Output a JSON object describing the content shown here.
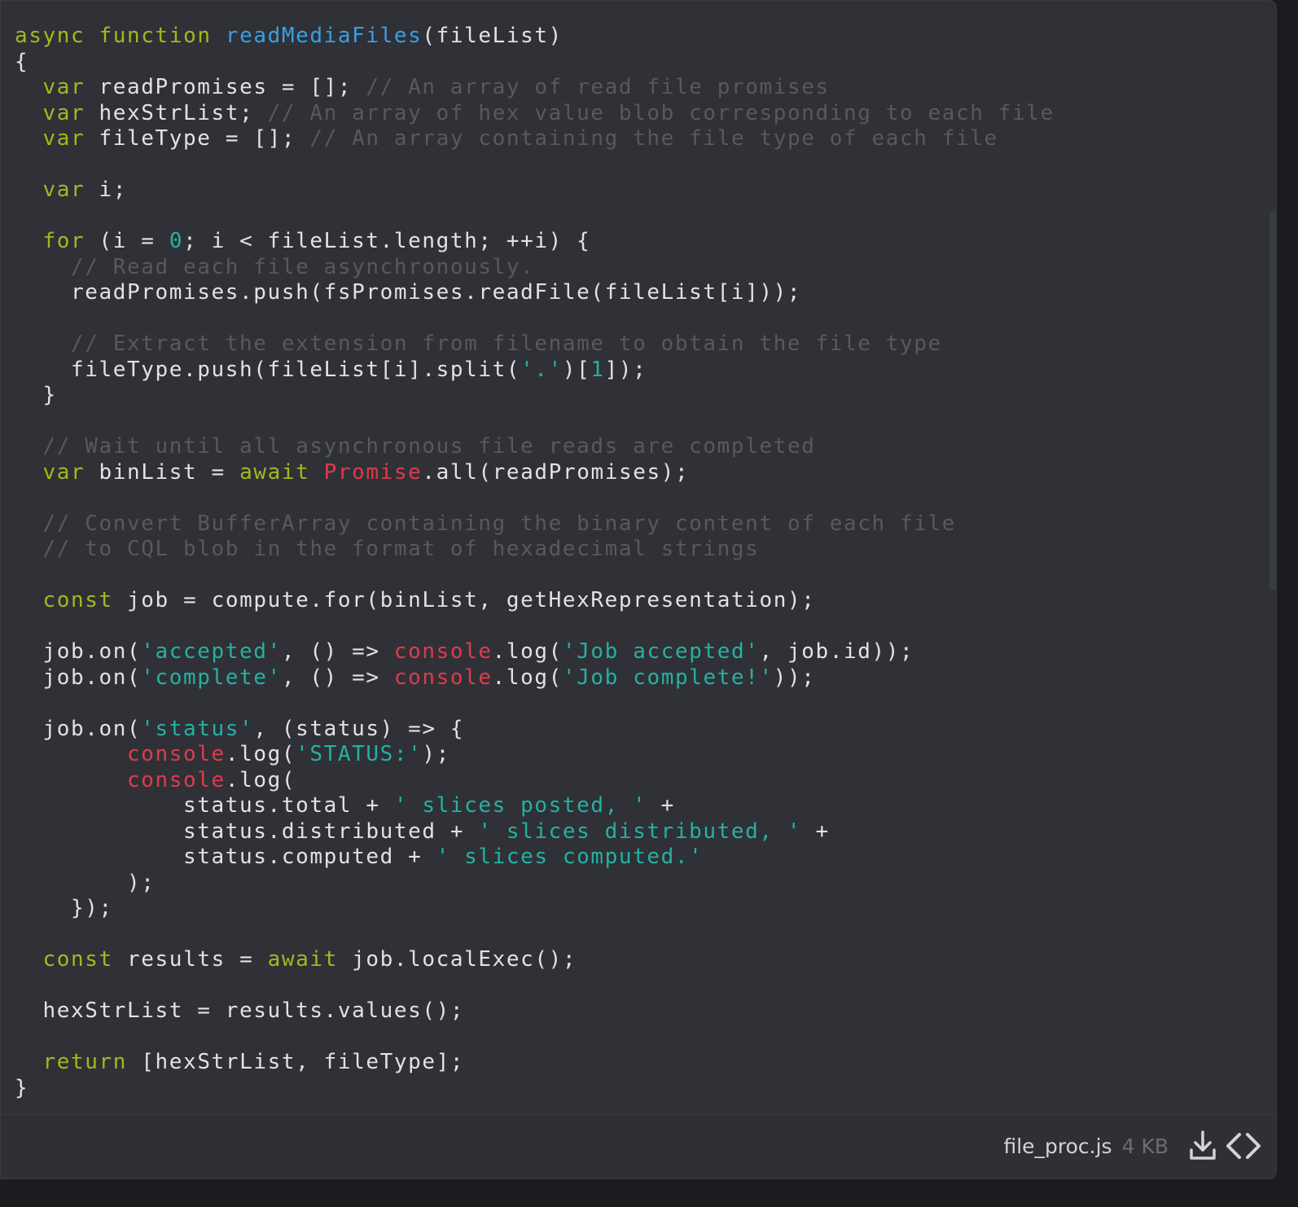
{
  "code_lines": [
    [
      {
        "t": "kw",
        "v": "async"
      },
      {
        "t": "pl",
        "v": " "
      },
      {
        "t": "kw",
        "v": "function"
      },
      {
        "t": "pl",
        "v": " "
      },
      {
        "t": "fn",
        "v": "readMediaFiles"
      },
      {
        "t": "pl",
        "v": "(fileList)"
      }
    ],
    [
      {
        "t": "pl",
        "v": "{"
      }
    ],
    [
      {
        "t": "pl",
        "v": "  "
      },
      {
        "t": "kw",
        "v": "var"
      },
      {
        "t": "pl",
        "v": " readPromises = []; "
      },
      {
        "t": "cm",
        "v": "// An array of read file promises"
      }
    ],
    [
      {
        "t": "pl",
        "v": "  "
      },
      {
        "t": "kw",
        "v": "var"
      },
      {
        "t": "pl",
        "v": " hexStrList; "
      },
      {
        "t": "cm",
        "v": "// An array of hex value blob corresponding to each file"
      }
    ],
    [
      {
        "t": "pl",
        "v": "  "
      },
      {
        "t": "kw",
        "v": "var"
      },
      {
        "t": "pl",
        "v": " fileType = []; "
      },
      {
        "t": "cm",
        "v": "// An array containing the file type of each file"
      }
    ],
    [],
    [
      {
        "t": "pl",
        "v": "  "
      },
      {
        "t": "kw",
        "v": "var"
      },
      {
        "t": "pl",
        "v": " i;"
      }
    ],
    [],
    [
      {
        "t": "pl",
        "v": "  "
      },
      {
        "t": "kw",
        "v": "for"
      },
      {
        "t": "pl",
        "v": " (i = "
      },
      {
        "t": "num",
        "v": "0"
      },
      {
        "t": "pl",
        "v": "; i < fileList.length; ++i) {"
      }
    ],
    [
      {
        "t": "pl",
        "v": "    "
      },
      {
        "t": "cm",
        "v": "// Read each file asynchronously."
      }
    ],
    [
      {
        "t": "pl",
        "v": "    readPromises.push(fsPromises.readFile(fileList[i]));"
      }
    ],
    [],
    [
      {
        "t": "pl",
        "v": "    "
      },
      {
        "t": "cm",
        "v": "// Extract the extension from filename to obtain the file type"
      }
    ],
    [
      {
        "t": "pl",
        "v": "    fileType.push(fileList[i].split("
      },
      {
        "t": "str",
        "v": "'.'"
      },
      {
        "t": "pl",
        "v": ")["
      },
      {
        "t": "num",
        "v": "1"
      },
      {
        "t": "pl",
        "v": "]);"
      }
    ],
    [
      {
        "t": "pl",
        "v": "  }"
      }
    ],
    [],
    [
      {
        "t": "pl",
        "v": "  "
      },
      {
        "t": "cm",
        "v": "// Wait until all asynchronous file reads are completed"
      }
    ],
    [
      {
        "t": "pl",
        "v": "  "
      },
      {
        "t": "kw",
        "v": "var"
      },
      {
        "t": "pl",
        "v": " binList = "
      },
      {
        "t": "kw",
        "v": "await"
      },
      {
        "t": "pl",
        "v": " "
      },
      {
        "t": "cls",
        "v": "Promise"
      },
      {
        "t": "pl",
        "v": ".all(readPromises);"
      }
    ],
    [],
    [
      {
        "t": "pl",
        "v": "  "
      },
      {
        "t": "cm",
        "v": "// Convert BufferArray containing the binary content of each file"
      }
    ],
    [
      {
        "t": "pl",
        "v": "  "
      },
      {
        "t": "cm",
        "v": "// to CQL blob in the format of hexadecimal strings"
      }
    ],
    [],
    [
      {
        "t": "pl",
        "v": "  "
      },
      {
        "t": "kw",
        "v": "const"
      },
      {
        "t": "pl",
        "v": " job = compute.for(binList, getHexRepresentation);"
      }
    ],
    [],
    [
      {
        "t": "pl",
        "v": "  job.on("
      },
      {
        "t": "str",
        "v": "'accepted'"
      },
      {
        "t": "pl",
        "v": ", () => "
      },
      {
        "t": "cls",
        "v": "console"
      },
      {
        "t": "pl",
        "v": ".log("
      },
      {
        "t": "str",
        "v": "'Job accepted'"
      },
      {
        "t": "pl",
        "v": ", job.id));"
      }
    ],
    [
      {
        "t": "pl",
        "v": "  job.on("
      },
      {
        "t": "str",
        "v": "'complete'"
      },
      {
        "t": "pl",
        "v": ", () => "
      },
      {
        "t": "cls",
        "v": "console"
      },
      {
        "t": "pl",
        "v": ".log("
      },
      {
        "t": "str",
        "v": "'Job complete!'"
      },
      {
        "t": "pl",
        "v": "));"
      }
    ],
    [],
    [
      {
        "t": "pl",
        "v": "  job.on("
      },
      {
        "t": "str",
        "v": "'status'"
      },
      {
        "t": "pl",
        "v": ", (status) => {"
      }
    ],
    [
      {
        "t": "pl",
        "v": "        "
      },
      {
        "t": "cls",
        "v": "console"
      },
      {
        "t": "pl",
        "v": ".log("
      },
      {
        "t": "str",
        "v": "'STATUS:'"
      },
      {
        "t": "pl",
        "v": ");"
      }
    ],
    [
      {
        "t": "pl",
        "v": "        "
      },
      {
        "t": "cls",
        "v": "console"
      },
      {
        "t": "pl",
        "v": ".log("
      }
    ],
    [
      {
        "t": "pl",
        "v": "            status.total + "
      },
      {
        "t": "str",
        "v": "' slices posted, '"
      },
      {
        "t": "pl",
        "v": " +"
      }
    ],
    [
      {
        "t": "pl",
        "v": "            status.distributed + "
      },
      {
        "t": "str",
        "v": "' slices distributed, '"
      },
      {
        "t": "pl",
        "v": " +"
      }
    ],
    [
      {
        "t": "pl",
        "v": "            status.computed + "
      },
      {
        "t": "str",
        "v": "' slices computed.'"
      }
    ],
    [
      {
        "t": "pl",
        "v": "        );"
      }
    ],
    [
      {
        "t": "pl",
        "v": "    });"
      }
    ],
    [],
    [
      {
        "t": "pl",
        "v": "  "
      },
      {
        "t": "kw",
        "v": "const"
      },
      {
        "t": "pl",
        "v": " results = "
      },
      {
        "t": "kw",
        "v": "await"
      },
      {
        "t": "pl",
        "v": " job.localExec();"
      }
    ],
    [],
    [
      {
        "t": "pl",
        "v": "  hexStrList = results.values();"
      }
    ],
    [],
    [
      {
        "t": "pl",
        "v": "  "
      },
      {
        "t": "kw",
        "v": "return"
      },
      {
        "t": "pl",
        "v": " [hexStrList, fileType];"
      }
    ],
    [
      {
        "t": "pl",
        "v": "}"
      }
    ]
  ],
  "footer": {
    "filename": "file_proc.js",
    "filesize": "4 KB",
    "download_icon": "download-icon",
    "embed_icon": "code-embed-icon"
  },
  "colors": {
    "background": "#2f3137",
    "keyword": "#a3b81d",
    "function_name": "#3a9fe0",
    "comment": "#57595f",
    "string": "#26b0a2",
    "builtin": "#e03a4a",
    "text": "#e2e2e2"
  }
}
